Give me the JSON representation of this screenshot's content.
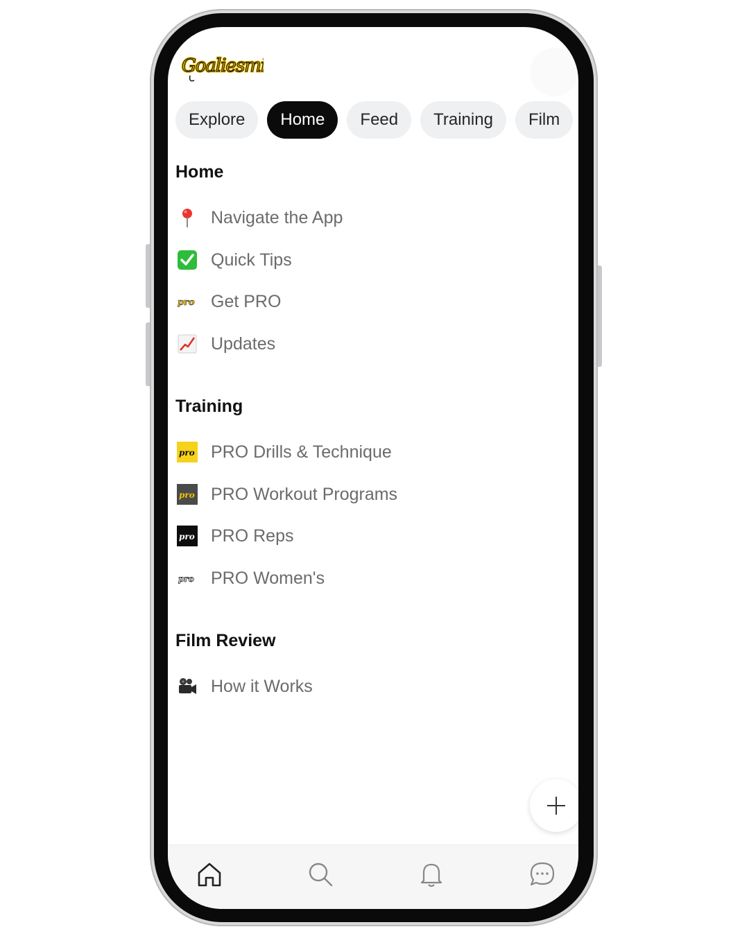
{
  "app": {
    "logo_text": "Goaliesmith"
  },
  "tabs": [
    {
      "label": "Explore",
      "active": false
    },
    {
      "label": "Home",
      "active": true
    },
    {
      "label": "Feed",
      "active": false
    },
    {
      "label": "Training",
      "active": false
    },
    {
      "label": "Film",
      "active": false
    }
  ],
  "sections": {
    "home": {
      "title": "Home",
      "items": [
        {
          "icon": "pushpin-icon",
          "label": "Navigate the App"
        },
        {
          "icon": "check-mark-icon",
          "label": "Quick Tips"
        },
        {
          "icon": "pro-badge-icon",
          "label": "Get PRO"
        },
        {
          "icon": "chart-increasing-icon",
          "label": "Updates"
        }
      ]
    },
    "training": {
      "title": "Training",
      "items": [
        {
          "icon": "pro-yellow-icon",
          "label": "PRO Drills & Technique"
        },
        {
          "icon": "pro-gray-icon",
          "label": "PRO Workout Programs"
        },
        {
          "icon": "pro-black-icon",
          "label": "PRO Reps"
        },
        {
          "icon": "pro-white-icon",
          "label": "PRO Women's"
        }
      ]
    },
    "film": {
      "title": "Film Review",
      "items": [
        {
          "icon": "movie-camera-icon",
          "label": "How it Works"
        }
      ]
    }
  },
  "fab": {
    "icon": "plus-icon"
  },
  "bottom_nav": [
    {
      "icon": "home-icon"
    },
    {
      "icon": "search-icon"
    },
    {
      "icon": "bell-icon"
    },
    {
      "icon": "chat-icon"
    }
  ],
  "colors": {
    "tab_active_bg": "#0b0b0b",
    "tab_bg": "#eff0f1",
    "label_gray": "#6b6b6b",
    "logo_gold": "#e8b800"
  }
}
